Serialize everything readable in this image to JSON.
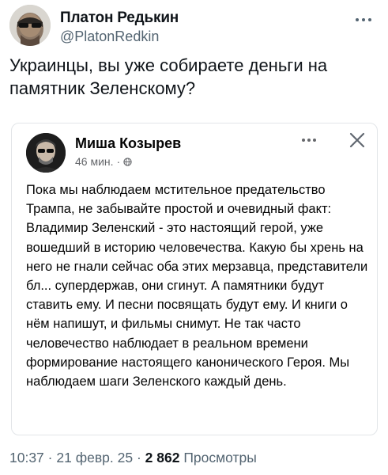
{
  "tweet": {
    "author_name": "Платон Редькин",
    "author_handle": "@PlatonRedkin",
    "text": "Украинцы, вы уже собираете деньги на памятник Зеленскому?"
  },
  "embed": {
    "author_name": "Миша Козырев",
    "time": "46 мин.",
    "separator": "·",
    "text": "Пока мы наблюдаем мстительное предательство Трампа, не забывайте простой и очевидный факт: Владимир Зеленский - это настоящий герой, уже вошедший в историю человечества. Какую бы хрень на него не гнали сейчас оба этих мерзавца, представители бл... супердержав, они сгинут. А памятники будут ставить ему. И песни посвящать будут ему. И книги о нём напишут, и фильмы снимут. Не так часто человечество наблюдает в реальном времени формирование настоящего канонического Героя. Мы наблюдаем шаги Зеленского каждый день."
  },
  "footer": {
    "time": "10:37",
    "date": "21 февр. 25",
    "views_count": "2 862",
    "views_label": "Просмотры",
    "separator": "·"
  },
  "icons": [
    "avatar",
    "more-icon",
    "avatar",
    "globe-icon",
    "more-icon",
    "close-icon"
  ]
}
